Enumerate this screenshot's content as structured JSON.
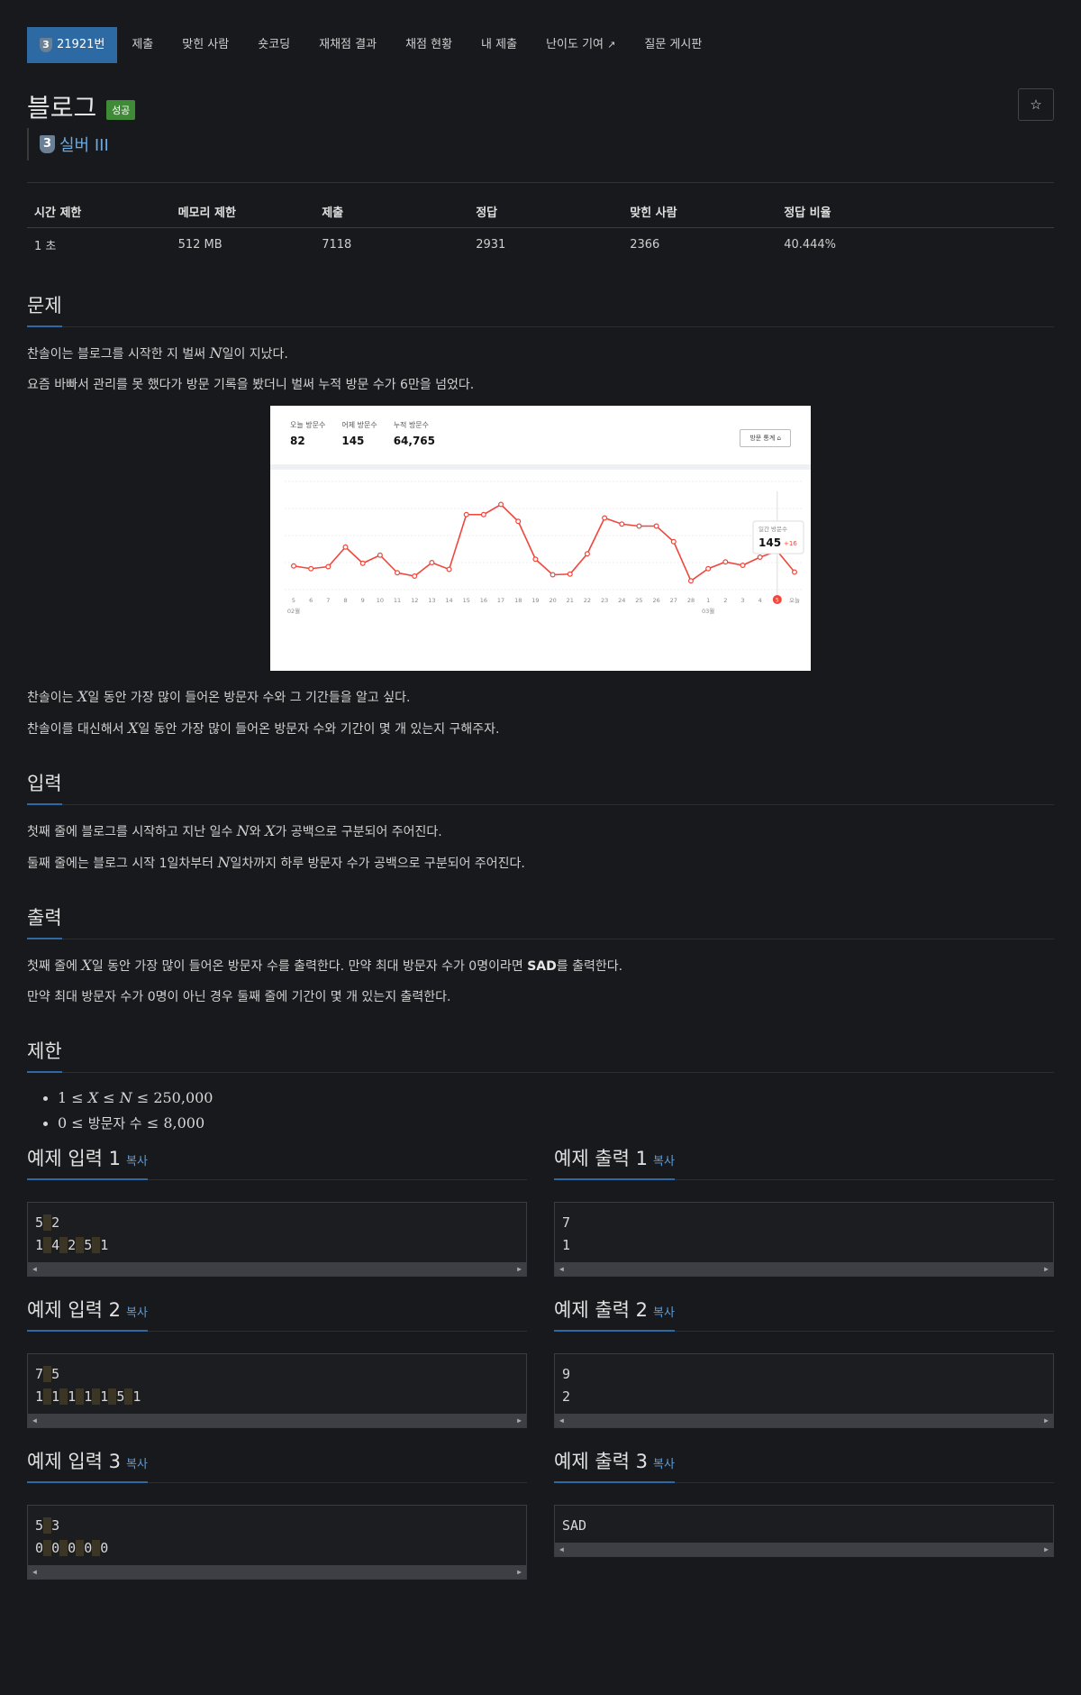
{
  "nav": {
    "problem_number": "21921번",
    "tier_digit": "3",
    "items": [
      "제출",
      "맞힌 사람",
      "숏코딩",
      "재채점 결과",
      "채점 현황",
      "내 제출",
      "난이도 기여",
      "질문 게시판"
    ]
  },
  "problem": {
    "title": "블로그",
    "status_badge": "성공",
    "tier_digit": "3",
    "tier_label": "실버 III",
    "star_icon": "star-outline-icon"
  },
  "info_table": {
    "headers": [
      "시간 제한",
      "메모리 제한",
      "제출",
      "정답",
      "맞힌 사람",
      "정답 비율"
    ],
    "values": [
      "1 초",
      "512 MB",
      "7118",
      "2931",
      "2366",
      "40.444%"
    ]
  },
  "sections": {
    "problem": {
      "title": "문제",
      "p1_pre": "찬솔이는 블로그를 시작한 지 벌써 ",
      "p1_var": "N",
      "p1_post": "일이 지났다.",
      "p2": "요즘 바빠서 관리를 못 했다가 방문 기록을 봤더니 벌써 누적 방문 수가 6만을 넘었다.",
      "p3_pre": "찬솔이는 ",
      "p3_var": "X",
      "p3_post": "일 동안 가장 많이 들어온 방문자 수와 그 기간들을 알고 싶다.",
      "p4_pre": "찬솔이를 대신해서 ",
      "p4_var": "X",
      "p4_post": "일 동안 가장 많이 들어온 방문자 수와 기간이 몇 개 있는지 구해주자."
    },
    "input": {
      "title": "입력",
      "p1_pre": "첫째 줄에 블로그를 시작하고 지난 일수 ",
      "p1_v1": "N",
      "p1_mid": "와 ",
      "p1_v2": "X",
      "p1_post": "가 공백으로 구분되어 주어진다.",
      "p2_pre": "둘째 줄에는 블로그 시작 1일차부터 ",
      "p2_var": "N",
      "p2_post": "일차까지 하루 방문자 수가 공백으로 구분되어 주어진다."
    },
    "output": {
      "title": "출력",
      "p1_pre": "첫째 줄에 ",
      "p1_var": "X",
      "p1_mid": "일 동안 가장 많이 들어온 방문자 수를 출력한다. 만약 최대 방문자 수가 0명이라면 ",
      "p1_bold": "SAD",
      "p1_post": "를 출력한다.",
      "p2": "만약 최대 방문자 수가 0명이 아닌 경우 둘째 줄에 기간이 몇 개 있는지 출력한다."
    },
    "limits": {
      "title": "제한",
      "l1_a": "1 ≤ ",
      "l1_b": "X",
      "l1_c": " ≤ ",
      "l1_d": "N",
      "l1_e": " ≤ 250,000",
      "l2_a": "0 ≤ ",
      "l2_b": "방문자 수",
      "l2_c": " ≤ 8,000"
    }
  },
  "figure": {
    "stats": [
      {
        "label": "오늘 방문수",
        "value": "82"
      },
      {
        "label": "어제 방문수",
        "value": "145"
      },
      {
        "label": "누적 방문수",
        "value": "64,765"
      }
    ],
    "trend_button": "방문 통계",
    "tooltip_label": "일간 방문수",
    "tooltip_value": "145",
    "tooltip_delta": "+16",
    "month_feb": "02월",
    "month_mar": "03월",
    "chart_data": {
      "type": "line",
      "categories": [
        "5",
        "6",
        "7",
        "8",
        "9",
        "10",
        "11",
        "12",
        "13",
        "14",
        "15",
        "16",
        "17",
        "18",
        "19",
        "20",
        "21",
        "22",
        "23",
        "24",
        "25",
        "26",
        "27",
        "28",
        "1",
        "2",
        "3",
        "4",
        "5",
        "오늘"
      ],
      "values": [
        35,
        31,
        34,
        63,
        39,
        51,
        25,
        20,
        40,
        30,
        111,
        111,
        126,
        101,
        45,
        22,
        23,
        53,
        106,
        97,
        94,
        94,
        71,
        13,
        31,
        41,
        36,
        48,
        57,
        26
      ],
      "ylim": [
        0,
        160
      ],
      "highlight_index": 28,
      "line_color": "#f0463c"
    }
  },
  "samples": {
    "copy_label": "복사",
    "in1_title": "예제 입력 1",
    "in1_lines": [
      "5 2",
      "1 4 2 5 1"
    ],
    "out1_title": "예제 출력 1",
    "out1_lines": [
      "7",
      "1"
    ],
    "in2_title": "예제 입력 2",
    "in2_lines": [
      "7 5",
      "1 1 1 1 1 5 1"
    ],
    "out2_title": "예제 출력 2",
    "out2_lines": [
      "9",
      "2"
    ],
    "in3_title": "예제 입력 3",
    "in3_lines": [
      "5 3",
      "0 0 0 0 0"
    ],
    "out3_title": "예제 출력 3",
    "out3_lines": [
      "SAD"
    ]
  }
}
